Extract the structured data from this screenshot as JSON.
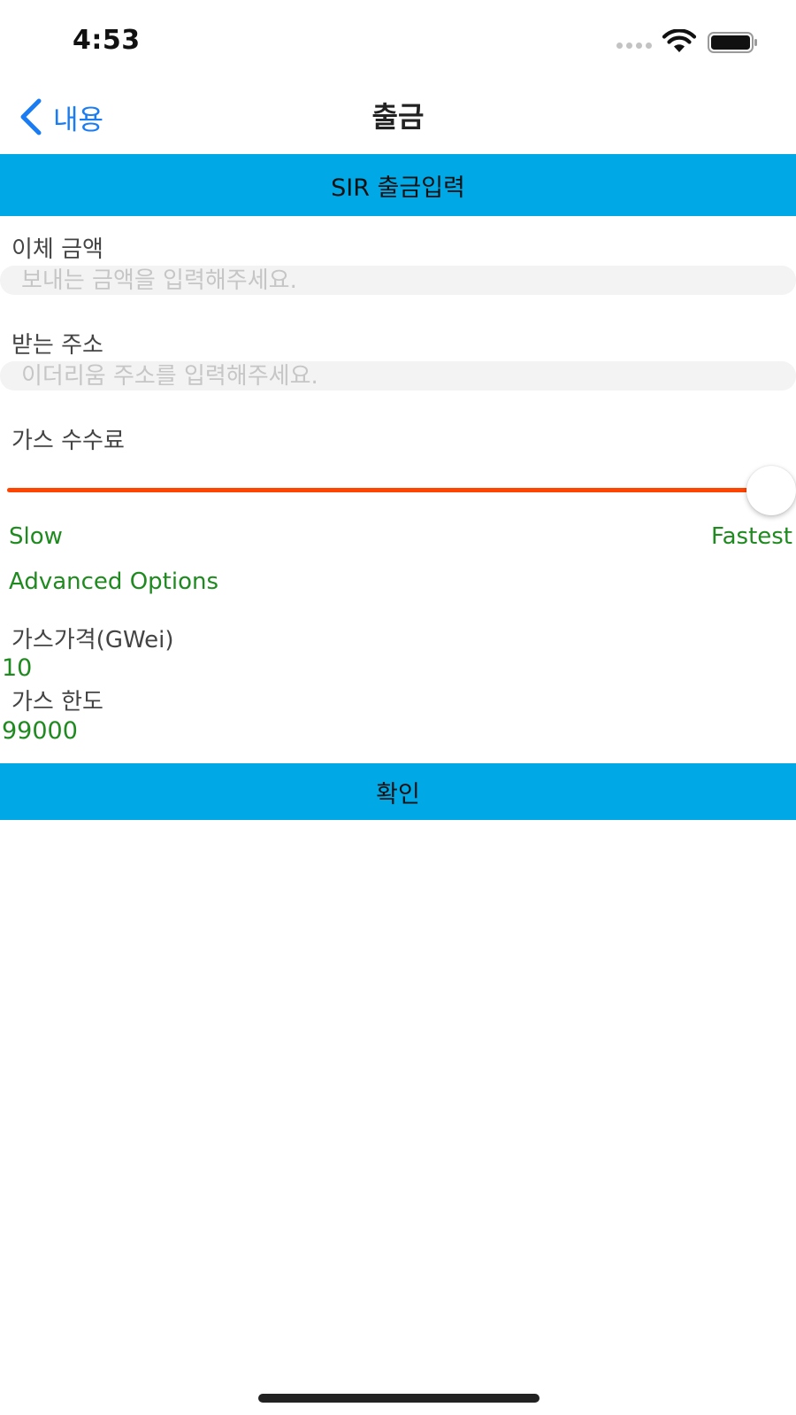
{
  "status_bar": {
    "time": "4:53",
    "icons": [
      "cellular-signal-icon",
      "wifi-icon",
      "battery-icon"
    ]
  },
  "nav": {
    "back_label": "내용",
    "title": "출금",
    "back_icon": "chevron-left-icon"
  },
  "section_header": "SIR 출금입력",
  "amount_field": {
    "label": "이체 금액",
    "value": "",
    "placeholder": "보내는 금액을 입력해주세요."
  },
  "address_field": {
    "label": "받는 주소",
    "value": "",
    "placeholder": "이더리움 주소를 입력해주세요."
  },
  "gas_fee": {
    "label": "가스 수수료",
    "slider_value": 1.0,
    "min_label": "Slow",
    "max_label": "Fastest"
  },
  "advanced_options_label": "Advanced Options",
  "gas_price": {
    "label": "가스가격(GWei)",
    "value": "10"
  },
  "gas_limit": {
    "label": "가스 한도",
    "value": "99000"
  },
  "confirm_label": "확인",
  "colors": {
    "accent": "#00a9e6",
    "slider_fill": "#ff4400",
    "link_blue": "#1a7cf2",
    "value_green": "#1f8a1f",
    "placeholder_gray": "#c6c6c6"
  }
}
